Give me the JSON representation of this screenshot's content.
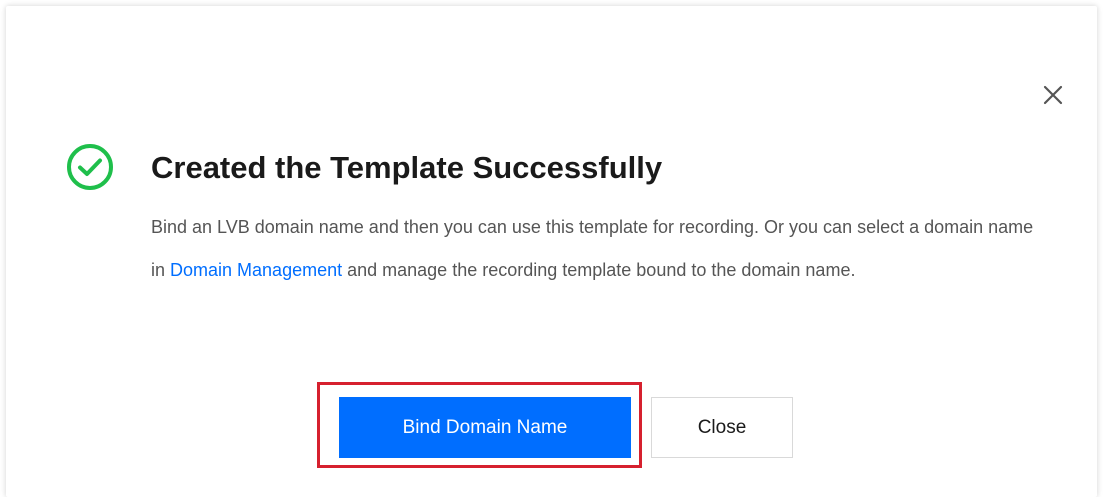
{
  "dialog": {
    "title": "Created the Template Successfully",
    "body_before_link": "Bind an LVB domain name and then you can use this template for recording. Or you can select a domain name in ",
    "link_text": "Domain Management",
    "body_after_link": " and manage the recording template bound to the domain name.",
    "icons": {
      "status": "check-circle-icon",
      "close": "close-icon"
    },
    "buttons": {
      "primary_label": "Bind Domain Name",
      "secondary_label": "Close"
    }
  },
  "colors": {
    "success": "#1fbf4b",
    "link": "#006eff",
    "primary_button": "#006eff",
    "highlight_border": "#d6202e",
    "title_text": "#1a1a1a",
    "body_text": "#555555"
  }
}
